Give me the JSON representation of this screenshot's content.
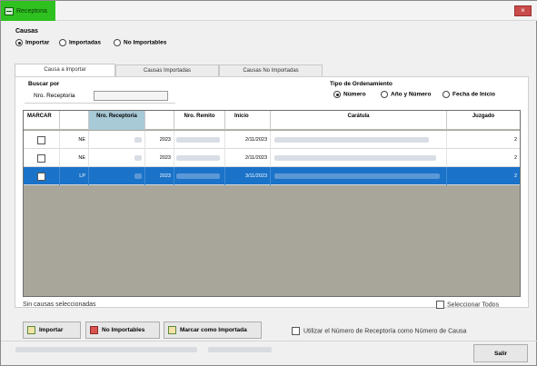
{
  "window": {
    "title": "Receptoria",
    "close_glyph": "×"
  },
  "causas": {
    "label": "Causas",
    "options": [
      {
        "label": "Importar",
        "selected": true
      },
      {
        "label": "Importadas",
        "selected": false
      },
      {
        "label": "No Importables",
        "selected": false
      }
    ]
  },
  "tabs": [
    {
      "label": "Causa a Importar",
      "active": true
    },
    {
      "label": "Causas Importadas",
      "active": false
    },
    {
      "label": "Causas No Importadas",
      "active": false
    }
  ],
  "buscar": {
    "label": "Buscar por",
    "field_label": "Nro. Receptoria",
    "value": ""
  },
  "orden": {
    "label": "Tipo de Ordenamiento",
    "options": [
      {
        "label": "Número",
        "selected": true
      },
      {
        "label": "Año y Número",
        "selected": false
      },
      {
        "label": "Fecha de Inicio",
        "selected": false
      }
    ]
  },
  "table": {
    "headers": [
      "MARCAR",
      "",
      "Nro. Receptoria",
      "",
      "Nro. Remito",
      "Inicio",
      "Carátula",
      "Juzgado"
    ],
    "rows": [
      {
        "tipo": "NE",
        "anio": "2023",
        "inicio": "2/11/2023",
        "juzgado": "2",
        "selected": false
      },
      {
        "tipo": "NE",
        "anio": "2023",
        "inicio": "2/11/2023",
        "juzgado": "2",
        "selected": false
      },
      {
        "tipo": "LP",
        "anio": "2023",
        "inicio": "3/11/2023",
        "juzgado": "2",
        "selected": true
      }
    ]
  },
  "status": {
    "seleccion": "Sin causas seleccionadas",
    "seleccionar_todos": "Seleccionar Todos"
  },
  "buttons": {
    "importar": "Importar",
    "no_importables": "No Importables",
    "marcar_importada": "Marcar como Importada",
    "salir": "Salir"
  },
  "usar_numero": "Utilizar el Número de Receptoría como Número de Causa",
  "colors": {
    "selection": "#1a73c8",
    "title_badge": "#2fc11f",
    "grid_bg": "#a8a59a"
  }
}
